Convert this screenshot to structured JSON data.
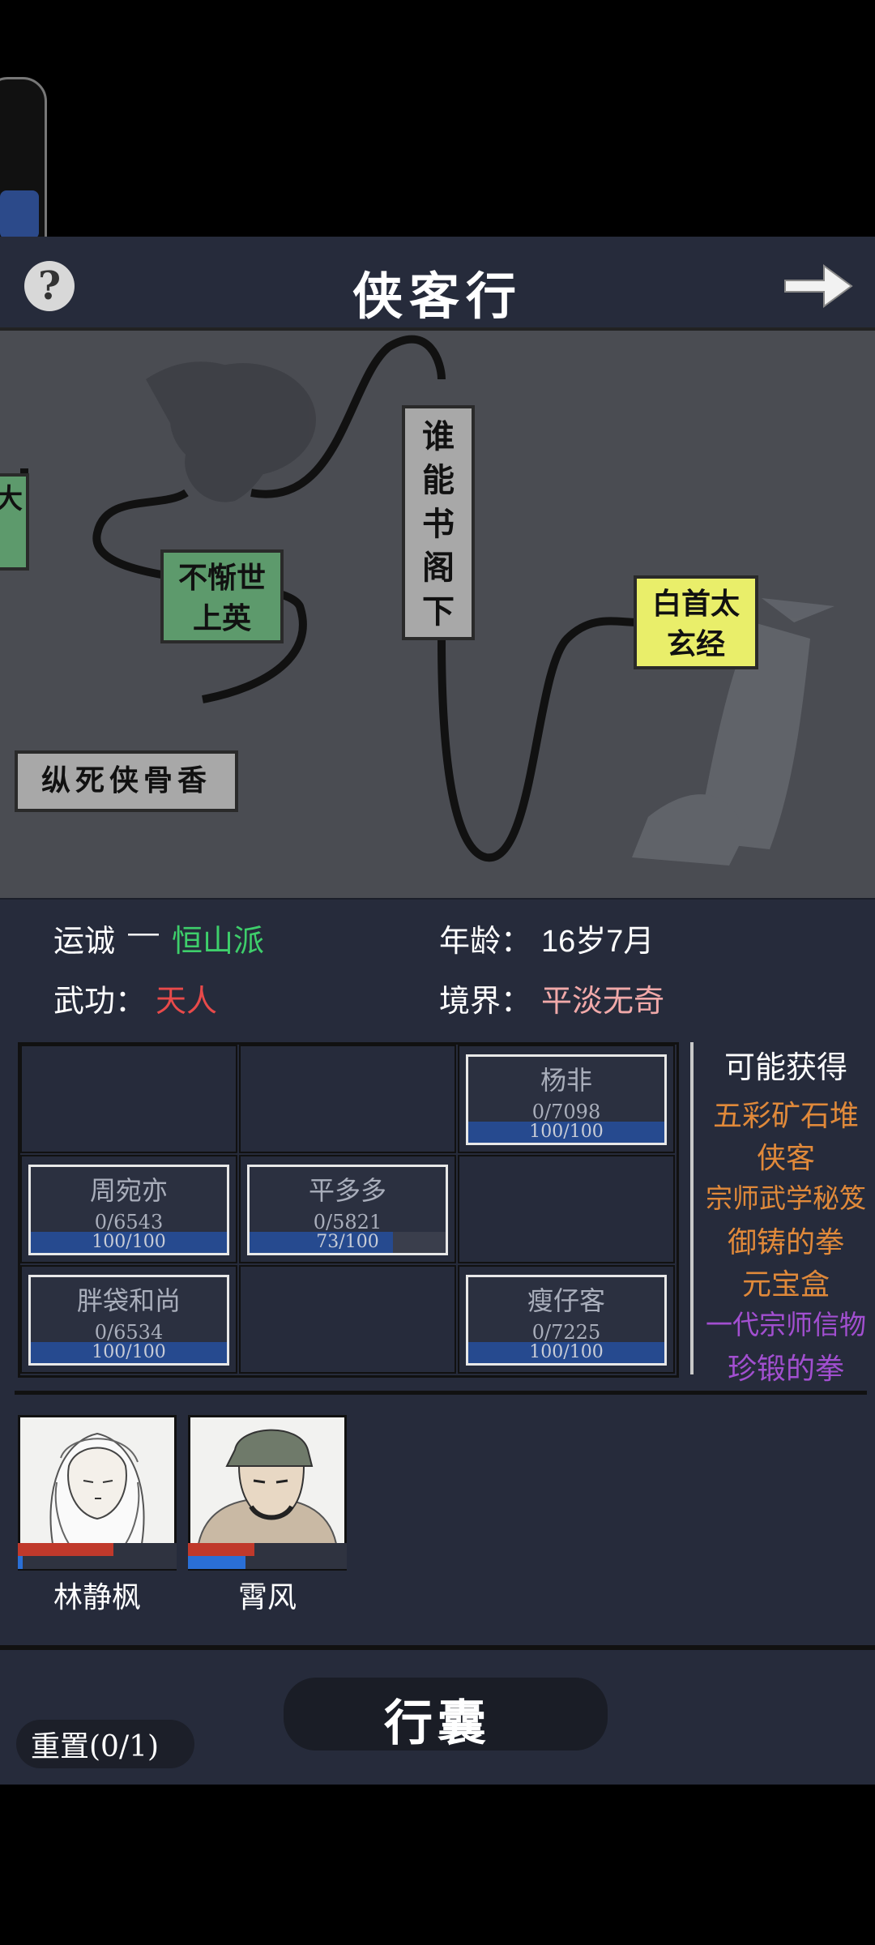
{
  "header": {
    "title": "侠客行",
    "help": "?"
  },
  "map": {
    "nodes": [
      {
        "id": "left-partial",
        "label": "大"
      },
      {
        "id": "buxie",
        "label": "不惭世上英"
      },
      {
        "id": "shuineng",
        "label": "谁能书阁下"
      },
      {
        "id": "baishou",
        "label": "白首太玄经"
      },
      {
        "id": "zongsi",
        "label": "纵死侠骨香"
      }
    ]
  },
  "info": {
    "luck_label": "运诚",
    "luck_dash": "—",
    "luck_value": "恒山派",
    "age_label": "年龄：",
    "age_value": "16岁7月",
    "martial_label": "武功：",
    "martial_value": "天人",
    "realm_label": "境界：",
    "realm_value": "平淡无奇"
  },
  "grid": {
    "cards": [
      {
        "name": "杨非",
        "progress": "0/7098",
        "hp": "100/100",
        "fill": 1.0
      },
      {
        "name": "周宛亦",
        "progress": "0/6543",
        "hp": "100/100",
        "fill": 1.0
      },
      {
        "name": "平多多",
        "progress": "0/5821",
        "hp": "73/100",
        "fill": 0.73
      },
      {
        "name": "胖袋和尚",
        "progress": "0/6534",
        "hp": "100/100",
        "fill": 1.0
      },
      {
        "name": "瘦仔客",
        "progress": "0/7225",
        "hp": "100/100",
        "fill": 1.0
      }
    ]
  },
  "rewards": {
    "title": "可能获得",
    "items": [
      {
        "label": "五彩矿石堆",
        "color": "#e0893a"
      },
      {
        "label": "侠客",
        "color": "#e0893a"
      },
      {
        "label": "宗师武学秘笈",
        "color": "#e0893a"
      },
      {
        "label": "御铸的拳",
        "color": "#e0893a"
      },
      {
        "label": "元宝盒",
        "color": "#e0893a"
      },
      {
        "label": "一代宗师信物",
        "color": "#a24fd0"
      },
      {
        "label": "珍锻的拳",
        "color": "#a24fd0"
      }
    ]
  },
  "team": [
    {
      "name": "林静枫",
      "hp": 0.6,
      "mp": 0.03
    },
    {
      "name": "霄风",
      "hp": 0.42,
      "mp": 0.36
    }
  ],
  "bottom": {
    "bag_label": "行囊",
    "reset_label": "重置(0/1)"
  },
  "colors": {
    "luck": "#3ecf6b",
    "martial": "#e84a4a",
    "realm": "#f1a9a9",
    "panel": "#262b3b"
  }
}
